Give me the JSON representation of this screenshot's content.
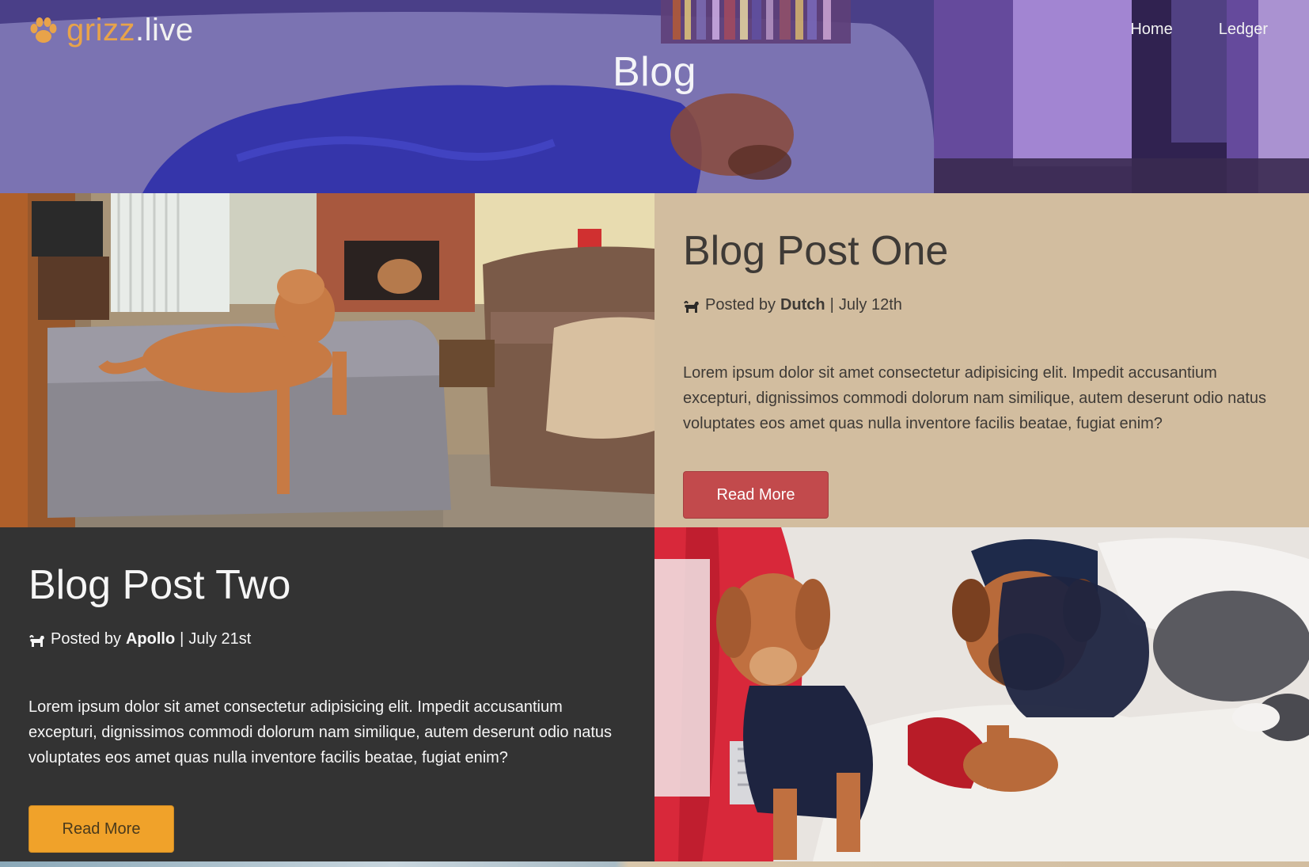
{
  "header": {
    "brand": {
      "name": "grizz",
      "tld": ".live",
      "icon": "paw-icon",
      "color": "#e8a34a"
    },
    "title": "Blog",
    "nav": [
      {
        "label": "Home"
      },
      {
        "label": "Ledger"
      }
    ]
  },
  "posts": [
    {
      "title": "Blog Post One",
      "meta_prefix": "Posted by",
      "author": "Dutch",
      "separator": "|",
      "date": "July 12th",
      "excerpt": "Lorem ipsum dolor sit amet consectetur adipisicing elit. Impedit accusantium excepturi, dignissimos commodi dolorum nam similique, autem deserunt odio natus voluptates eos amet quas nulla inventore facilis beatae, fugiat enim?",
      "button": "Read More",
      "button_color": "#c24a4c",
      "panel_color": "#d2bd9f",
      "icon": "dog-icon"
    },
    {
      "title": "Blog Post Two",
      "meta_prefix": "Posted by",
      "author": "Apollo",
      "separator": "|",
      "date": "July 21st",
      "excerpt": "Lorem ipsum dolor sit amet consectetur adipisicing elit. Impedit accusantium excepturi, dignissimos commodi dolorum nam similique, autem deserunt odio natus voluptates eos amet quas nulla inventore facilis beatae, fugiat enim?",
      "button": "Read More",
      "button_color": "#f0a22a",
      "panel_color": "#333333",
      "icon": "dog-icon"
    }
  ]
}
